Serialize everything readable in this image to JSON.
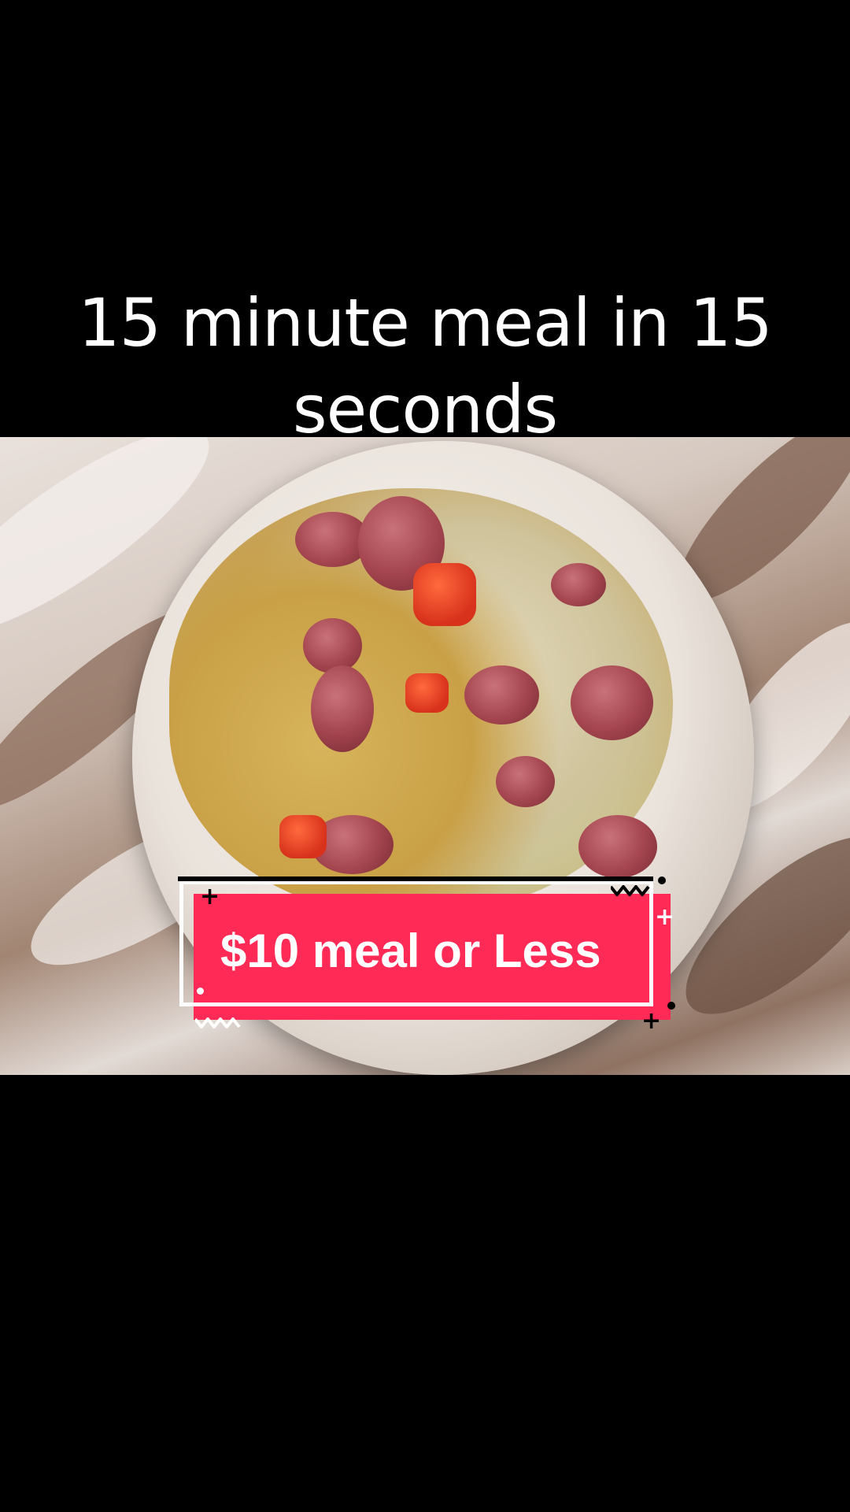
{
  "caption": {
    "title": "15 minute meal in 15 seconds"
  },
  "sticker": {
    "label": "$10 meal or Less",
    "color": "#ff2a55"
  },
  "video": {
    "subject": "bowl of rice, cabbage, tomato and sausage on marble countertop"
  }
}
